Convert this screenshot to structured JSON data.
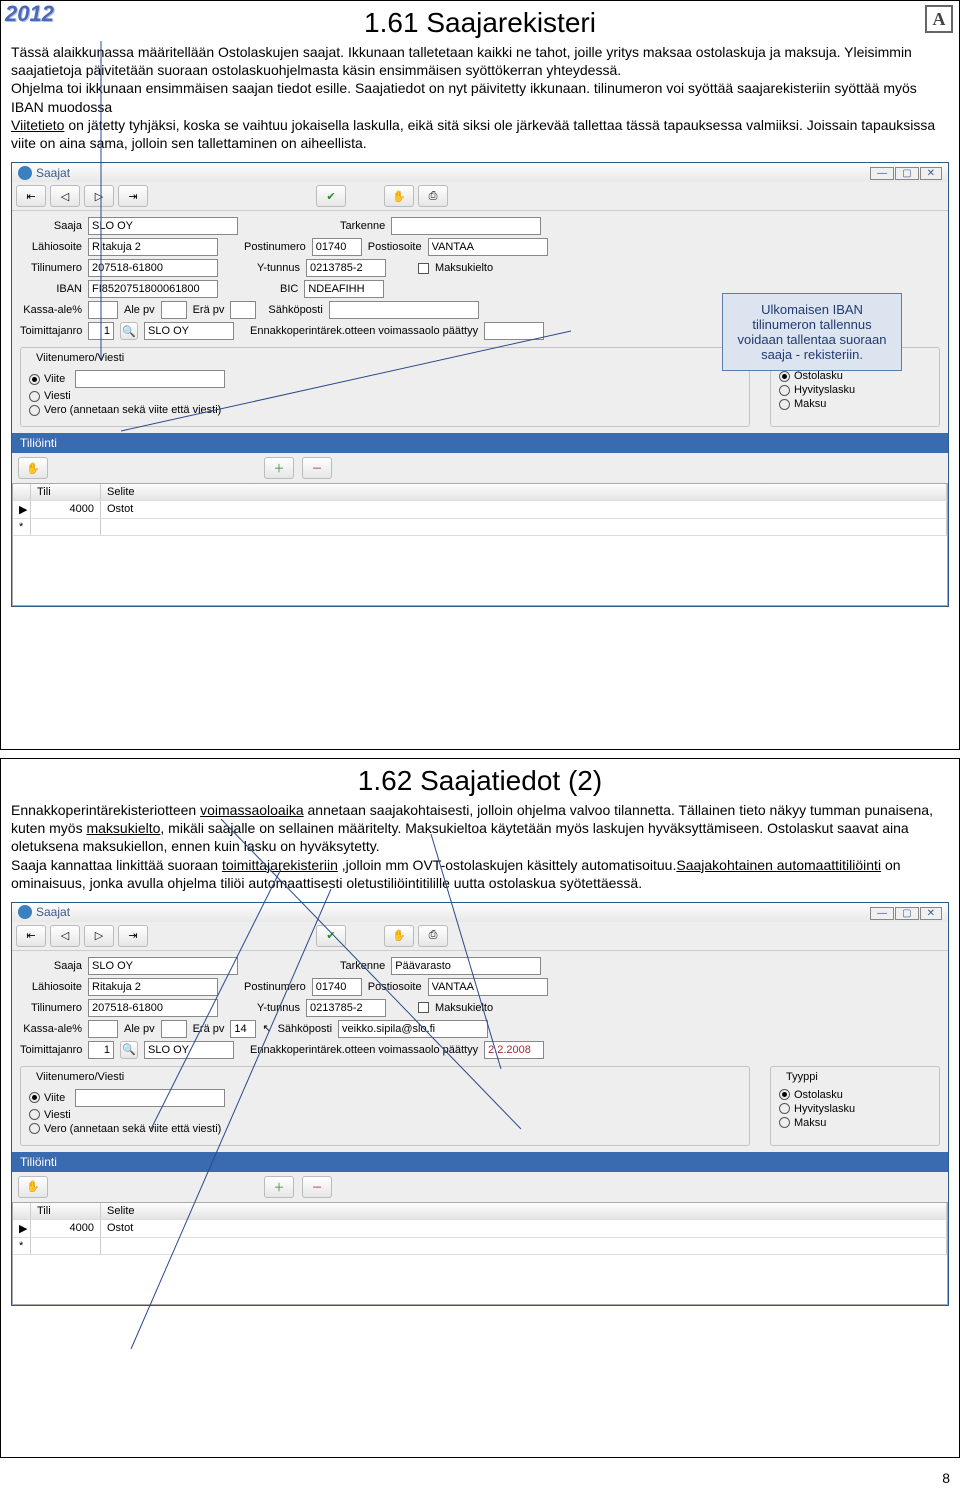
{
  "year": "2012",
  "corner": "A",
  "section1": {
    "title": "1.61 Saajarekisteri",
    "p1a": "Tässä alaikkunassa määritellään Ostolaskujen saajat. Ikkunaan talletetaan kaikki ne tahot, joille yritys maksaa ostolaskuja ja maksuja. Yleisimmin saajatietoja päivitetään suoraan ostolaskuohjelmasta käsin ensimmäisen syöttökerran yhteydessä.",
    "p1b": "Ohjelma toi ikkunaan ensimmäisen saajan tiedot esille. Saajatiedot on nyt päivitetty ikkunaan. tilinumeron voi syöttää saajarekisteriin syöttää myös IBAN muodossa",
    "p1c_pre": "Viitetieto",
    "p1c": " on jätetty tyhjäksi, koska se vaihtuu jokaisella laskulla, eikä sitä siksi ole järkevää tallettaa tässä tapauksessa valmiiksi. Joissain tapauksissa viite on aina sama, jolloin sen tallettaminen on aiheellista.",
    "callout": "Ulkomaisen IBAN tilinumeron tallennus voidaan tallentaa suoraan saaja - rekisteriin."
  },
  "win": {
    "title": "Saajat",
    "icons": {
      "check": "✔",
      "hand": "✋",
      "print": "⎙",
      "plus": "＋",
      "minus": "－"
    },
    "labels": {
      "saaja": "Saaja",
      "tarkenne": "Tarkenne",
      "lahiosoite": "Lähiosoite",
      "postinumero": "Postinumero",
      "postiosoite": "Postiosoite",
      "tilinumero": "Tilinumero",
      "ytunnus": "Y-tunnus",
      "maksukielto": "Maksukielto",
      "iban": "IBAN",
      "bic": "BIC",
      "kassaale": "Kassa-ale%",
      "alepv": "Ale pv",
      "erapv": "Erä pv",
      "sahkoposti": "Sähköposti",
      "toimittajanro": "Toimittajanro",
      "ennakko": "Ennakkoperintärek.otteen voimassaolo päättyy",
      "viitenumero": "Viitenumero/Viesti",
      "tyyppi": "Tyyppi",
      "viite": "Viite",
      "viesti": "Viesti",
      "vero": "Vero (annetaan sekä viite että viesti)",
      "ostolasku": "Ostolasku",
      "hyvityslasku": "Hyvityslasku",
      "maksu": "Maksu"
    }
  },
  "s1f": {
    "saaja": "SLO OY",
    "tarkenne": "",
    "lahiosoite": "Ritakuja 2",
    "postinumero": "01740",
    "postiosoite": "VANTAA",
    "tilinumero": "207518-61800",
    "ytunnus": "0213785-2",
    "iban": "FI8520751800061800",
    "bic": "NDEAFIHH",
    "kassaale": "",
    "alepv": "",
    "erapv": "",
    "sahkoposti": "",
    "toimittajanro": "1",
    "toimittajanimi": "SLO OY",
    "ennakko_pv": ""
  },
  "tili": {
    "head": "Tiliöinti",
    "cols": {
      "tili": "Tili",
      "selite": "Selite"
    },
    "row": {
      "tili": "4000",
      "selite": "Ostot"
    }
  },
  "section2": {
    "title": "1.62 Saajatiedot (2)",
    "t1": "Ennakkoperintärekisteriotteen ",
    "t1u": "voimassaoloaika",
    "t2": " annetaan saajakohtaisesti, jolloin ohjelma valvoo tilannetta. Tällainen tieto näkyy tumman punaisena, kuten myös ",
    "t2u": "maksukielto",
    "t3": ", mikäli saajalle on sellainen määritelty. Maksukieltoa käytetään myös laskujen hyväksyttämiseen. Ostolaskut saavat aina oletuksena maksukiellon, ennen kuin lasku on hyväksytetty.",
    "t4": "Saaja kannattaa linkittää suoraan ",
    "t4u": "toimittajarekisteriin",
    "t5": " ,jolloin mm OVT-ostolaskujen käsittely automatisoituu.",
    "t6u": "Saajakohtainen automaattitiliöinti",
    "t7": " on ominaisuus, jonka avulla ohjelma tiliöi automaattisesti oletustiliöintitilille uutta ostolaskua syötettäessä."
  },
  "s2f": {
    "saaja": "SLO OY",
    "tarkenne": "Päävarasto",
    "lahiosoite": "Ritakuja 2",
    "postinumero": "01740",
    "postiosoite": "VANTAA",
    "tilinumero": "207518-61800",
    "ytunnus": "0213785-2",
    "kassaale": "",
    "alepv": "",
    "erapv": "14",
    "sahkoposti": "veikko.sipila@slo.fi",
    "toimittajanro": "1",
    "toimittajanimi": "SLO OY",
    "ennakko_pv": "2.2.2008"
  },
  "pagenum": "8"
}
